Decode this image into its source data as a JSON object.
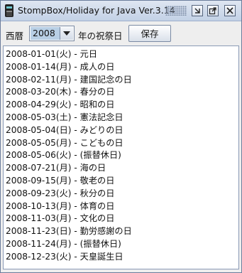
{
  "window": {
    "title": "StompBox/Holiday for Java Ver.3.14",
    "icon": "app-icon",
    "controls": [
      "minimize-icon",
      "maximize-icon",
      "close-icon"
    ]
  },
  "toolbar": {
    "year_label": "西暦",
    "year_value": "2008",
    "suffix_label": "年の祝祭日",
    "save_label": "保存"
  },
  "holidays": [
    "2008-01-01(火) - 元日",
    "2008-01-14(月) - 成人の日",
    "2008-02-11(月) - 建国記念の日",
    "2008-03-20(木) - 春分の日",
    "2008-04-29(火) - 昭和の日",
    "2008-05-03(土) - 憲法記念日",
    "2008-05-04(日) - みどりの日",
    "2008-05-05(月) - こどもの日",
    "2008-05-06(火) - (振替休日)",
    "2008-07-21(月) - 海の日",
    "2008-09-15(月) - 敬老の日",
    "2008-09-23(火) - 秋分の日",
    "2008-10-13(月) - 体育の日",
    "2008-11-03(月) - 文化の日",
    "2008-11-23(日) - 勤労感謝の日",
    "2008-11-24(月) - (振替休日)",
    "2008-12-23(火) - 天皇誕生日"
  ]
}
